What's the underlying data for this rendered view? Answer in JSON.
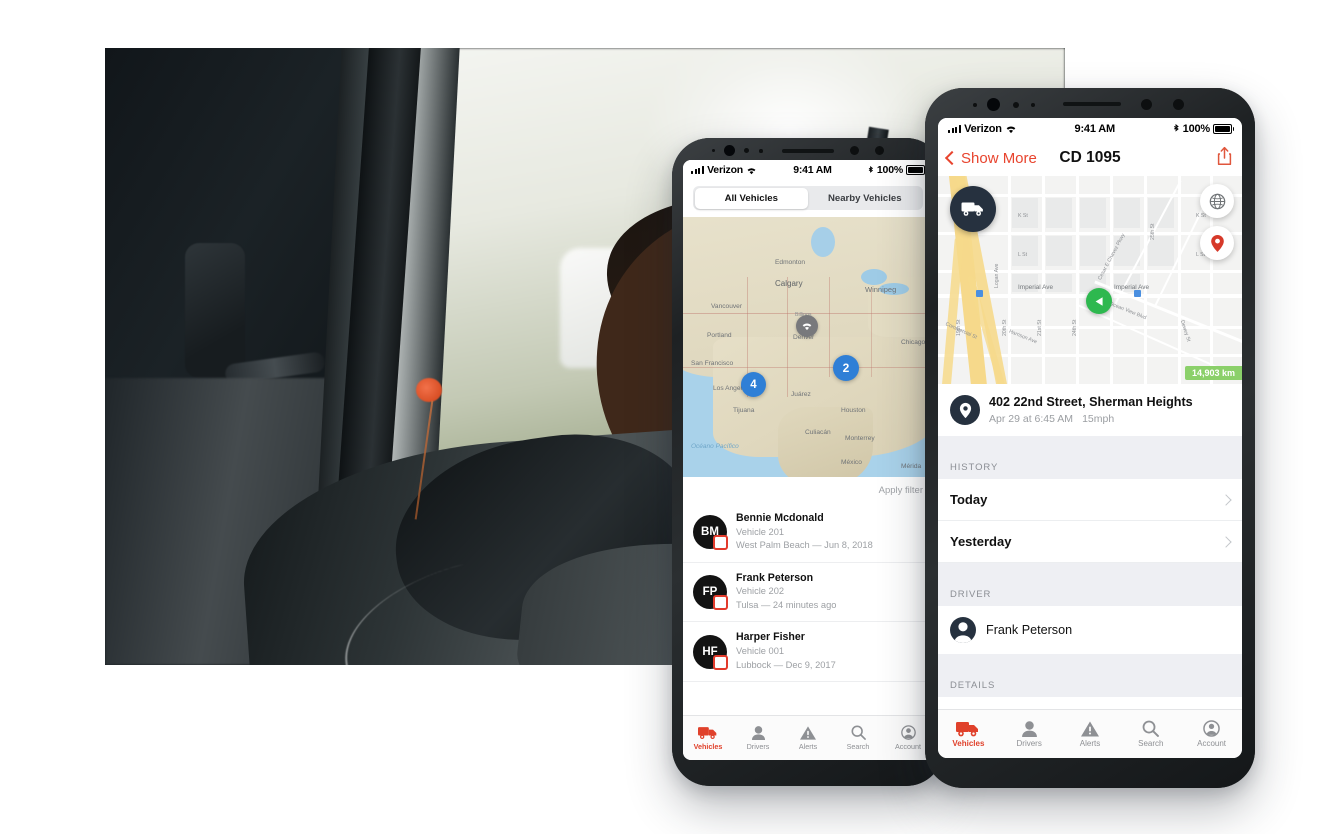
{
  "photo": {
    "alt": "Delivery driver sitting in truck cab using a tablet"
  },
  "back_phone": {
    "status_bar": {
      "carrier": "Verizon",
      "time": "9:41 AM",
      "battery": "100%"
    },
    "segmented": {
      "options": [
        "All Vehicles",
        "Nearby Vehicles"
      ],
      "selected": "All Vehicles"
    },
    "map": {
      "clusters": [
        {
          "count": "4"
        },
        {
          "count": "2"
        }
      ],
      "labels": [
        "Edmonton",
        "Calgary",
        "Winnipeg",
        "Vancouver",
        "Billings",
        "Portland",
        "Denver",
        "San Francisco",
        "Los Angeles",
        "Tijuana",
        "Juárez",
        "Houston",
        "Chicago",
        "Culiacán",
        "Monterrey",
        "México",
        "Mérida",
        "Océano Pacífico"
      ]
    },
    "apply_filter": "Apply filter",
    "vehicles": [
      {
        "initials": "BM",
        "name": "Bennie Mcdonald",
        "vehicle": "Vehicle 201",
        "status": "West Palm Beach — Jun 8, 2018"
      },
      {
        "initials": "FP",
        "name": "Frank Peterson",
        "vehicle": "Vehicle 202",
        "status": "Tulsa — 24 minutes ago"
      },
      {
        "initials": "HF",
        "name": "Harper Fisher",
        "vehicle": "Vehicle 001",
        "status": "Lubbock — Dec 9, 2017"
      }
    ],
    "tabs": [
      {
        "label": "Vehicles",
        "icon": "truck-icon",
        "active": true
      },
      {
        "label": "Drivers",
        "icon": "person-icon",
        "active": false
      },
      {
        "label": "Alerts",
        "icon": "warning-triangle-icon",
        "active": false
      },
      {
        "label": "Search",
        "icon": "search-icon",
        "active": false
      },
      {
        "label": "Account",
        "icon": "account-circle-icon",
        "active": false
      }
    ]
  },
  "front_phone": {
    "status_bar": {
      "carrier": "Verizon",
      "time": "9:41 AM",
      "battery": "100%"
    },
    "nav": {
      "back_label": "Show More",
      "title": "CD 1095",
      "share_icon": "share-icon"
    },
    "map": {
      "distance_badge": "14,903 km",
      "street_labels": [
        "K St",
        "L St",
        "Imperial Ave",
        "Imperial Ave",
        "K St",
        "L St",
        "19th St",
        "20th St",
        "21st St",
        "24th St",
        "25th St",
        "Ocean View Blvd",
        "Harrison Ave",
        "Commercial St",
        "Logan Ave",
        "Cesar E Chavez Pkwy",
        "Dewey St"
      ],
      "fab_layers_icon": "globe-layers-icon",
      "fab_locate_icon": "map-pin-icon",
      "vehicle_marker_icon": "truck-icon",
      "heading_marker_icon": "direction-arrow-icon"
    },
    "address": {
      "title": "402 22nd Street, Sherman Heights",
      "time": "Apr 29 at 6:45 AM",
      "speed": "15mph"
    },
    "sections": {
      "history": {
        "header": "HISTORY",
        "rows": [
          "Today",
          "Yesterday"
        ]
      },
      "driver": {
        "header": "DRIVER",
        "name": "Frank Peterson"
      },
      "details": {
        "header": "DETAILS"
      }
    },
    "tabs": [
      {
        "label": "Vehicles",
        "icon": "truck-icon",
        "active": true
      },
      {
        "label": "Drivers",
        "icon": "person-icon",
        "active": false
      },
      {
        "label": "Alerts",
        "icon": "warning-triangle-icon",
        "active": false
      },
      {
        "label": "Search",
        "icon": "search-icon",
        "active": false
      },
      {
        "label": "Account",
        "icon": "account-circle-icon",
        "active": false
      }
    ]
  },
  "colors": {
    "accent_red": "#e0412b",
    "marker_navy": "#26313f",
    "cluster_blue": "#2f7fd6",
    "badge_green": "#8bd06a",
    "arrow_green": "#2eb84f"
  }
}
